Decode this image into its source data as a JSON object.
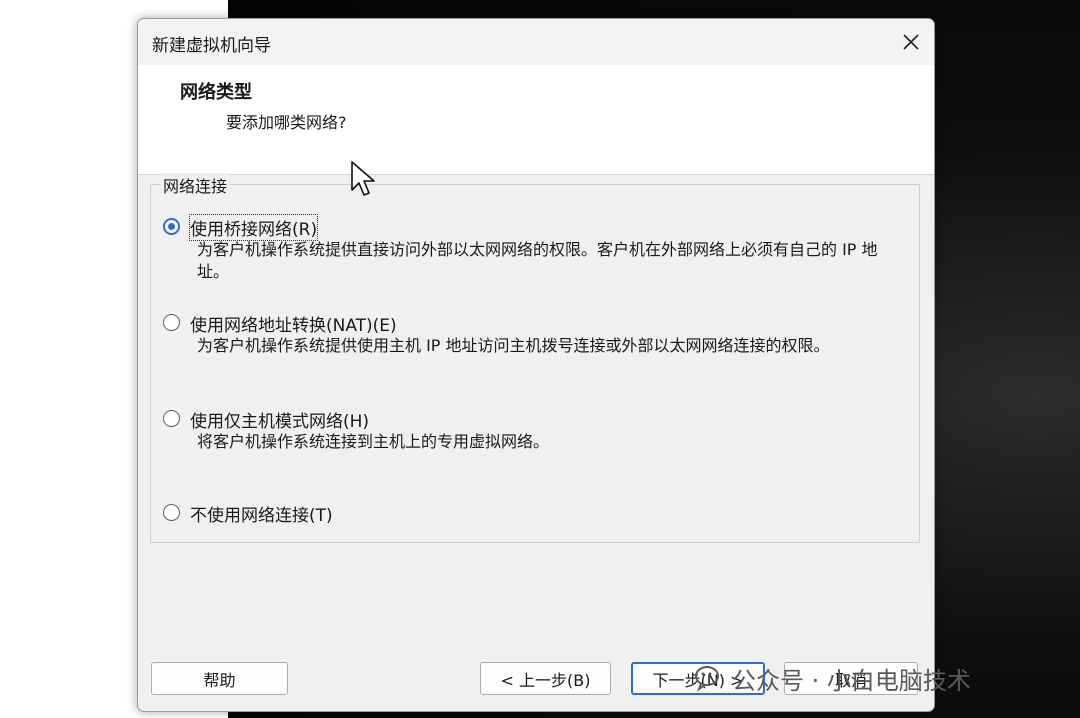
{
  "window": {
    "title": "新建虚拟机向导"
  },
  "header": {
    "title": "网络类型",
    "subtitle": "要添加哪类网络?"
  },
  "group": {
    "label": "网络连接"
  },
  "options": [
    {
      "label": "使用桥接网络(R)",
      "desc": "为客户机操作系统提供直接访问外部以太网网络的权限。客户机在外部网络上必须有自己的 IP 地址。",
      "checked": true
    },
    {
      "label": "使用网络地址转换(NAT)(E)",
      "desc": "为客户机操作系统提供使用主机 IP 地址访问主机拨号连接或外部以太网网络连接的权限。",
      "checked": false
    },
    {
      "label": "使用仅主机模式网络(H)",
      "desc": "将客户机操作系统连接到主机上的专用虚拟网络。",
      "checked": false
    },
    {
      "label": "不使用网络连接(T)",
      "desc": "",
      "checked": false
    }
  ],
  "buttons": {
    "help": "帮助",
    "back": "< 上一步(B)",
    "next": "下一步(N) >",
    "cancel": "取消"
  },
  "watermark": {
    "text": "公众号 · 小白电脑技术"
  },
  "colors": {
    "accent": "#2d6ae0",
    "dialog_bg": "#f0f0f0",
    "header_bg": "#ffffff"
  },
  "icons": {
    "close": "close-icon",
    "cursor": "mouse-pointer-icon",
    "watermark": "wechat-logo-icon"
  }
}
